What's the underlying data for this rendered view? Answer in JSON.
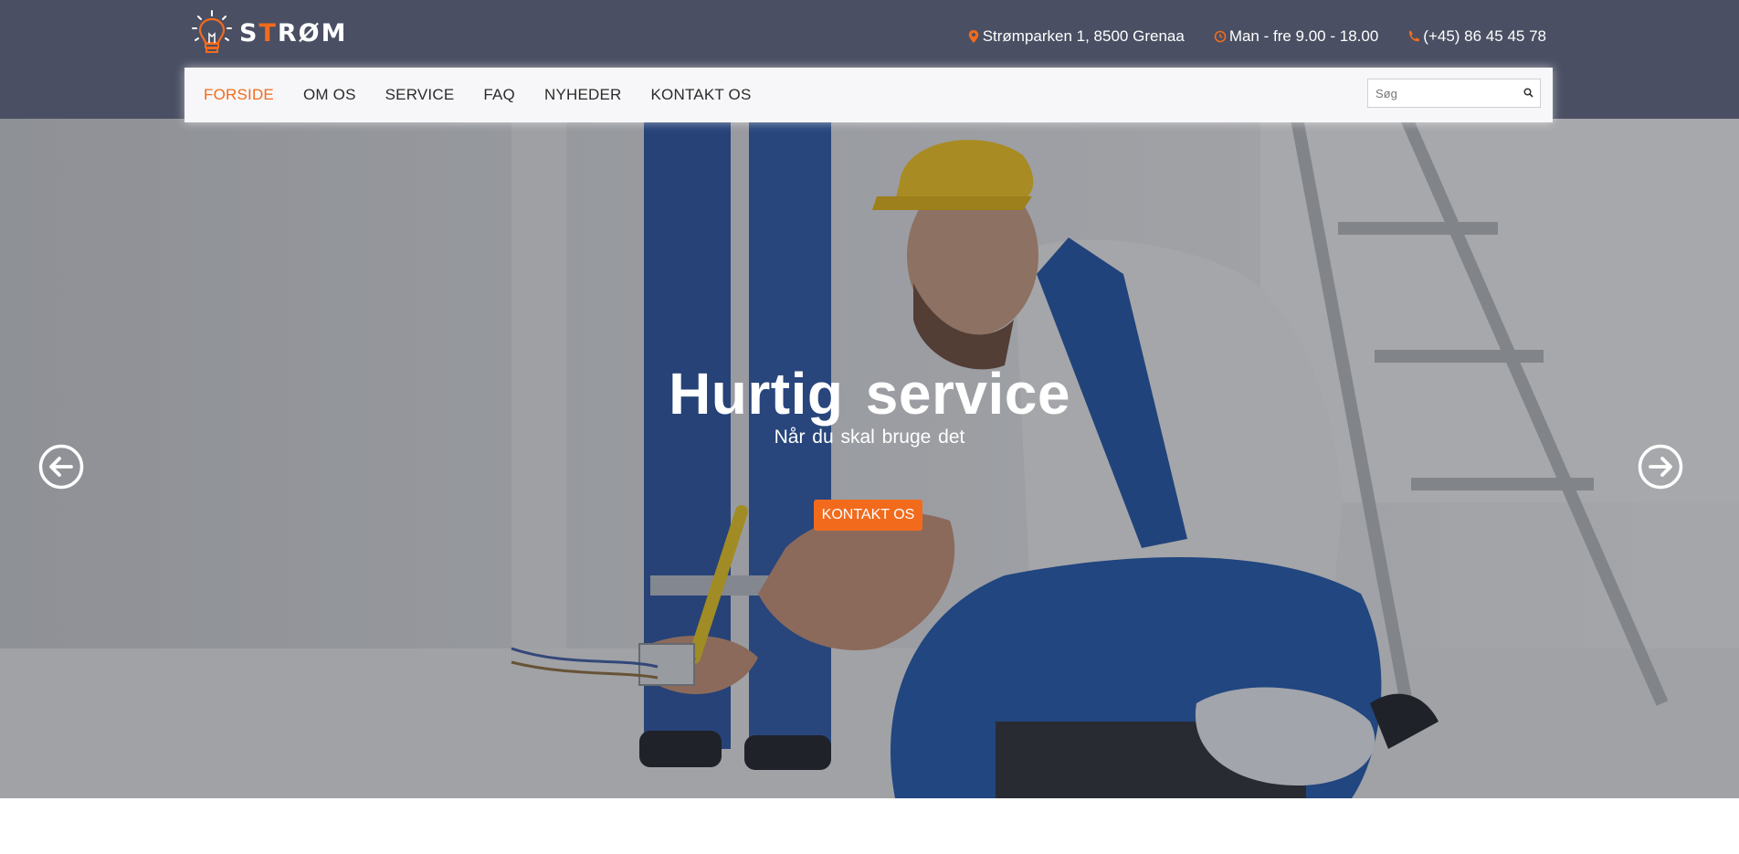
{
  "brand": {
    "logo_prefix": "S",
    "logo_accent": "T",
    "logo_suffix": "RØM",
    "accent_color": "#f26b1d",
    "header_bg": "#4a4f63"
  },
  "contact": {
    "address": "Strømparken 1, 8500 Grenaa",
    "hours": "Man - fre 9.00 - 18.00",
    "phone": "(+45) 86 45 45 78",
    "icons": [
      "map-pin-icon",
      "clock-icon",
      "phone-icon"
    ]
  },
  "nav": {
    "items": [
      {
        "label": "FORSIDE",
        "active": true
      },
      {
        "label": "OM OS",
        "active": false
      },
      {
        "label": "SERVICE",
        "active": false
      },
      {
        "label": "FAQ",
        "active": false
      },
      {
        "label": "NYHEDER",
        "active": false
      },
      {
        "label": "KONTAKT OS",
        "active": false
      }
    ],
    "search_placeholder": "Søg"
  },
  "hero": {
    "title": "Hurtig service",
    "subtitle": "Når du skal bruge det",
    "button_label": "KONTAKT OS",
    "image": "electrician-at-work"
  }
}
